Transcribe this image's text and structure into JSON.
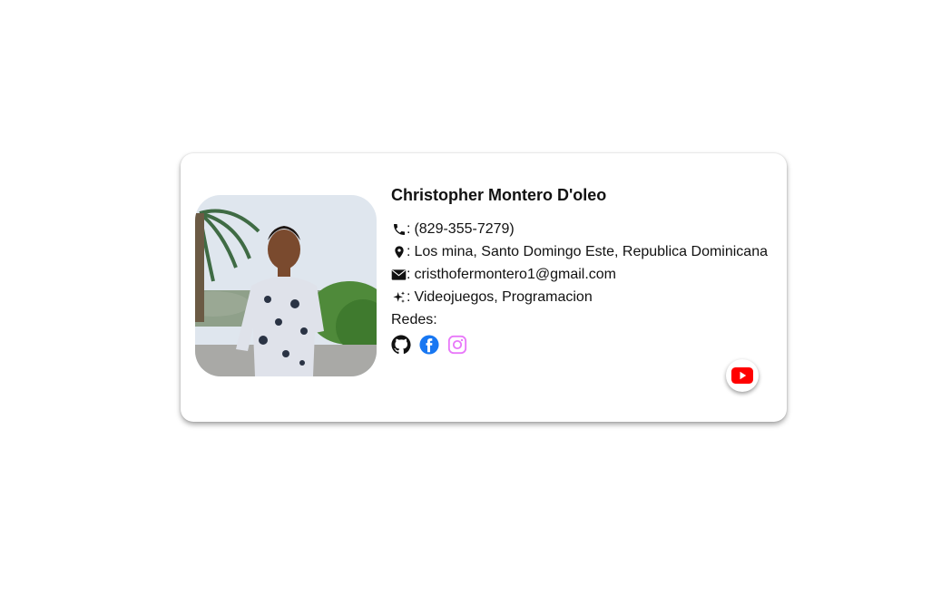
{
  "profile": {
    "name": "Christopher Montero D'oleo",
    "phone": "(829-355-7279)",
    "location": "Los mina, Santo Domingo Este, Republica Dominicana",
    "email": "cristhofermontero1@gmail.com",
    "interests": "Videojuegos, Programacion",
    "separator": ":",
    "socials_label": "Redes:"
  },
  "icons": {
    "phone": "phone-icon",
    "location": "map-pin-icon",
    "email": "envelope-icon",
    "interests": "sparkles-icon",
    "github": "github-icon",
    "facebook": "facebook-icon",
    "instagram": "instagram-icon",
    "youtube": "youtube-icon"
  },
  "colors": {
    "facebook": "#1877f2",
    "instagram": "#e879f9",
    "youtube": "#ff0000"
  }
}
